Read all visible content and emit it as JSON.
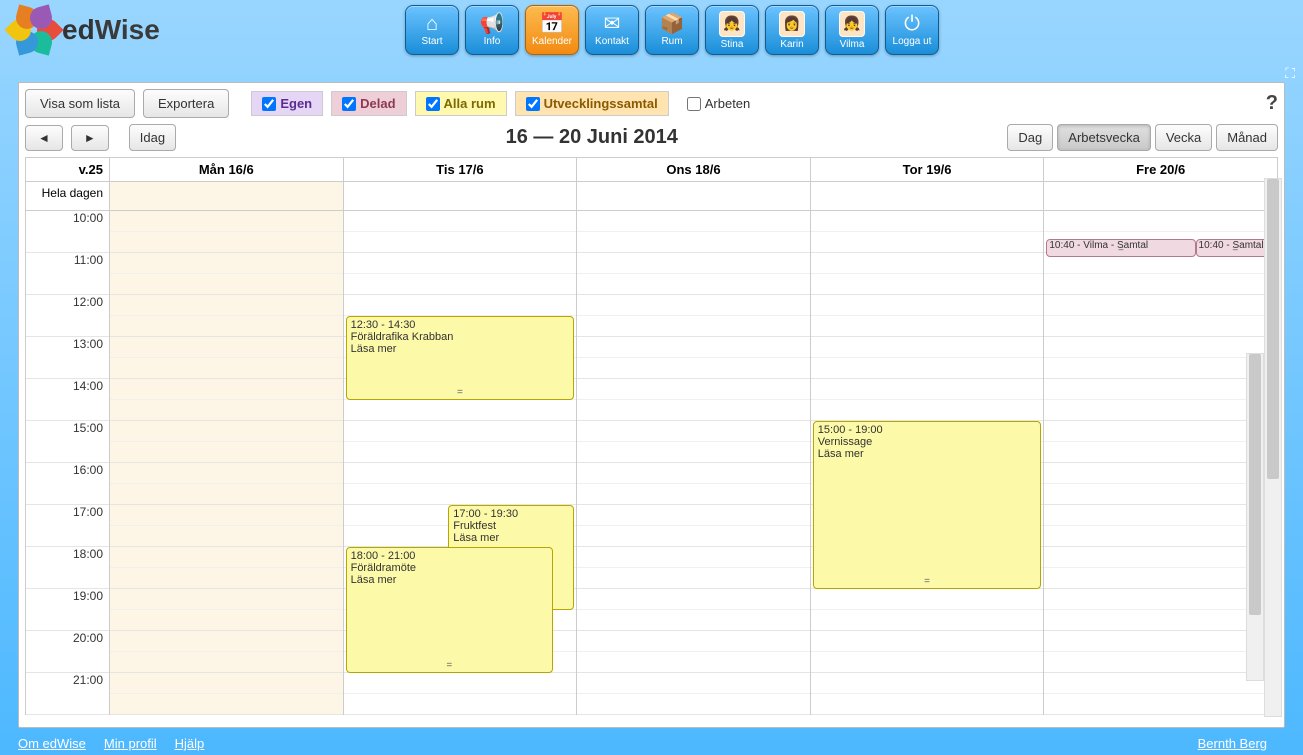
{
  "brand": {
    "name_prefix": "ed",
    "name_suffix": "Wise"
  },
  "nav": [
    {
      "label": "Start",
      "icon": "⌂",
      "type": "icon"
    },
    {
      "label": "Info",
      "icon": "📢",
      "type": "icon"
    },
    {
      "label": "Kalender",
      "icon": "📅",
      "type": "icon",
      "active": true
    },
    {
      "label": "Kontakt",
      "icon": "✉",
      "type": "icon"
    },
    {
      "label": "Rum",
      "icon": "📦",
      "type": "icon"
    },
    {
      "label": "Stina",
      "icon": "👧",
      "type": "avatar"
    },
    {
      "label": "Karin",
      "icon": "👩",
      "type": "avatar"
    },
    {
      "label": "Vilma",
      "icon": "👧",
      "type": "avatar"
    },
    {
      "label": "Logga ut",
      "icon": "⏻",
      "type": "icon"
    }
  ],
  "toolbar": {
    "list_view": "Visa som lista",
    "export": "Exportera",
    "today": "Idag",
    "prev": "◄",
    "next": "►",
    "help": "?"
  },
  "filters": [
    {
      "key": "egen",
      "label": "Egen",
      "checked": true
    },
    {
      "key": "delad",
      "label": "Delad",
      "checked": true
    },
    {
      "key": "allarum",
      "label": "Alla rum",
      "checked": true
    },
    {
      "key": "utv",
      "label": "Utvecklingssamtal",
      "checked": true
    },
    {
      "key": "arbeten",
      "label": "Arbeten",
      "checked": false
    }
  ],
  "title": "16 — 20 Juni 2014",
  "views": {
    "day": "Dag",
    "workweek": "Arbetsvecka",
    "week": "Vecka",
    "month": "Månad"
  },
  "week_label": "v.25",
  "allday_label": "Hela dagen",
  "days": [
    {
      "label": "Mån 16/6",
      "key": "mon"
    },
    {
      "label": "Tis 17/6",
      "key": "tue"
    },
    {
      "label": "Ons 18/6",
      "key": "wed"
    },
    {
      "label": "Tor 19/6",
      "key": "thu"
    },
    {
      "label": "Fre 20/6",
      "key": "fri"
    }
  ],
  "hours": [
    "10:00",
    "11:00",
    "12:00",
    "13:00",
    "14:00",
    "15:00",
    "16:00",
    "17:00",
    "18:00",
    "19:00",
    "20:00",
    "21:00"
  ],
  "events": {
    "tue1": {
      "time": "12:30 - 14:30",
      "title": "Föräldrafika Krabban",
      "more": "Läsa mer"
    },
    "tue2": {
      "time": "17:00 - 19:30",
      "title": "Fruktfest",
      "more": "Läsa mer"
    },
    "tue3": {
      "time": "18:00 - 21:00",
      "title": "Föräldramöte",
      "more": "Läsa mer"
    },
    "thu1": {
      "time": "15:00 - 19:00",
      "title": "Vernissage",
      "more": "Läsa mer"
    },
    "fri1": {
      "text": "10:40 - Vilma - Samtal"
    },
    "fri2": {
      "text": "10:40 - Samtal"
    }
  },
  "footer": {
    "about": "Om edWise",
    "profile": "Min profil",
    "help": "Hjälp",
    "user": "Bernth Berg"
  }
}
